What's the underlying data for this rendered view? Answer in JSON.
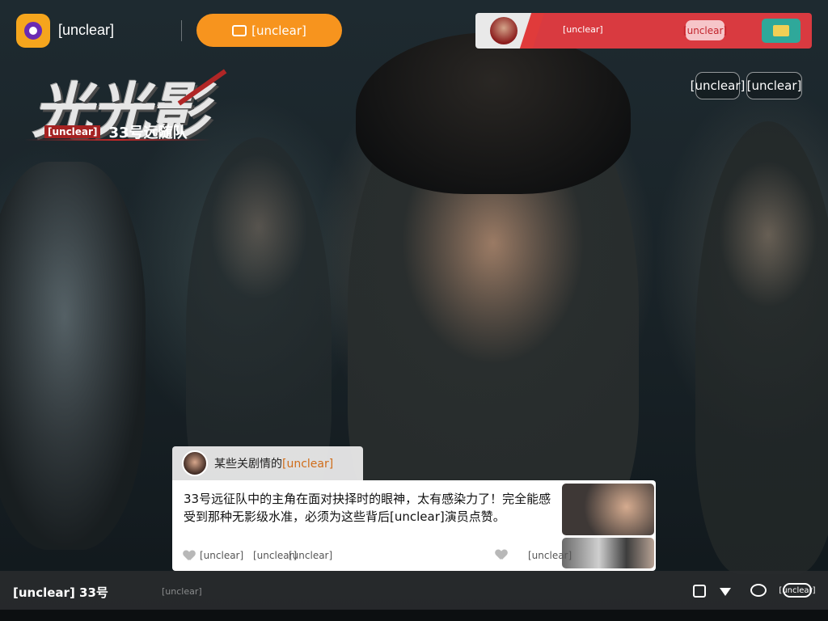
{
  "app": {
    "name": "[unclear]",
    "promo_button": "[unclear]"
  },
  "notification": {
    "text": "[unclear]",
    "pill": "[unclear]"
  },
  "top_right_buttons": {
    "quality": "[unclear]",
    "other": "[unclear]"
  },
  "show": {
    "title_logo": "光光影",
    "subtitle_red": "[unclear]",
    "subtitle": "33号远随队"
  },
  "comment": {
    "header_label": "某些关剧情的",
    "header_accent": "[unclear]",
    "text": "33号远征队中的主角在面对抉择时的眼神，太有感染力了！完全能感受到那种无影级水准，必须为这些背后[unclear]演员点赞。",
    "action_like": "[unclear]",
    "action_reply": "[unclear]",
    "action_share": "[unclear]",
    "action_right": "[unclear]"
  },
  "player": {
    "now_playing": "[unclear] 33号",
    "sub_text": "[unclear]",
    "danmu_label": "[unclear]"
  },
  "colors": {
    "promo_orange": "#f7941e",
    "notice_red": "#d93a40",
    "notice_green": "#2fa89a",
    "logo_orange": "#f5a51d",
    "logo_purple": "#6a2bb3"
  }
}
